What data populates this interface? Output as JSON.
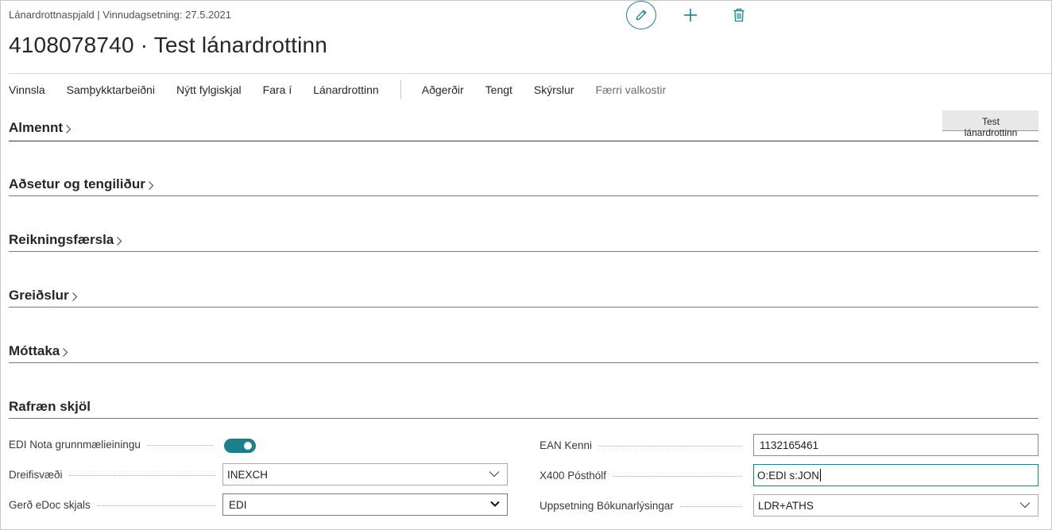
{
  "header": {
    "caption": "Lánardrottnaspjald | Vinnudagsetning: 27.5.2021",
    "title": "4108078740 · Test lánardrottinn"
  },
  "top_actions": {
    "edit_icon": "pencil-icon",
    "new_icon": "plus-icon",
    "delete_icon": "trash-icon",
    "accent_color": "#1b7f8c"
  },
  "actionbar": {
    "items": [
      "Vinnsla",
      "Samþykktarbeiðni",
      "Nýtt fylgiskjal",
      "Fara í",
      "Lánardrottinn"
    ],
    "items2": [
      "Aðgerðir",
      "Tengt",
      "Skýrslur"
    ],
    "fewer": "Færri valkostir"
  },
  "sections": {
    "general": {
      "title": "Almennt",
      "summary": "Test lánardrottinn"
    },
    "address": {
      "title": "Aðsetur og tengiliður"
    },
    "invoicing": {
      "title": "Reikningsfærsla"
    },
    "payments": {
      "title": "Greiðslur"
    },
    "receiving": {
      "title": "Móttaka"
    },
    "edoc": {
      "title": "Rafræn skjöl"
    }
  },
  "edoc_fields": {
    "edi_uom": {
      "label": "EDI Nota grunnmælieiningu",
      "value": true
    },
    "distribution": {
      "label": "Dreifisvæði",
      "value": "INEXCH"
    },
    "doc_type": {
      "label": "Gerð eDoc skjals",
      "value": "EDI"
    },
    "ean": {
      "label": "EAN Kenni",
      "value": "1132165461"
    },
    "x400": {
      "label": "X400 Pósthólf",
      "value": "O:EDI s:JON"
    },
    "posting_setup": {
      "label": "Uppsetning Bókunarlýsingar",
      "value": "LDR+ATHS"
    }
  }
}
